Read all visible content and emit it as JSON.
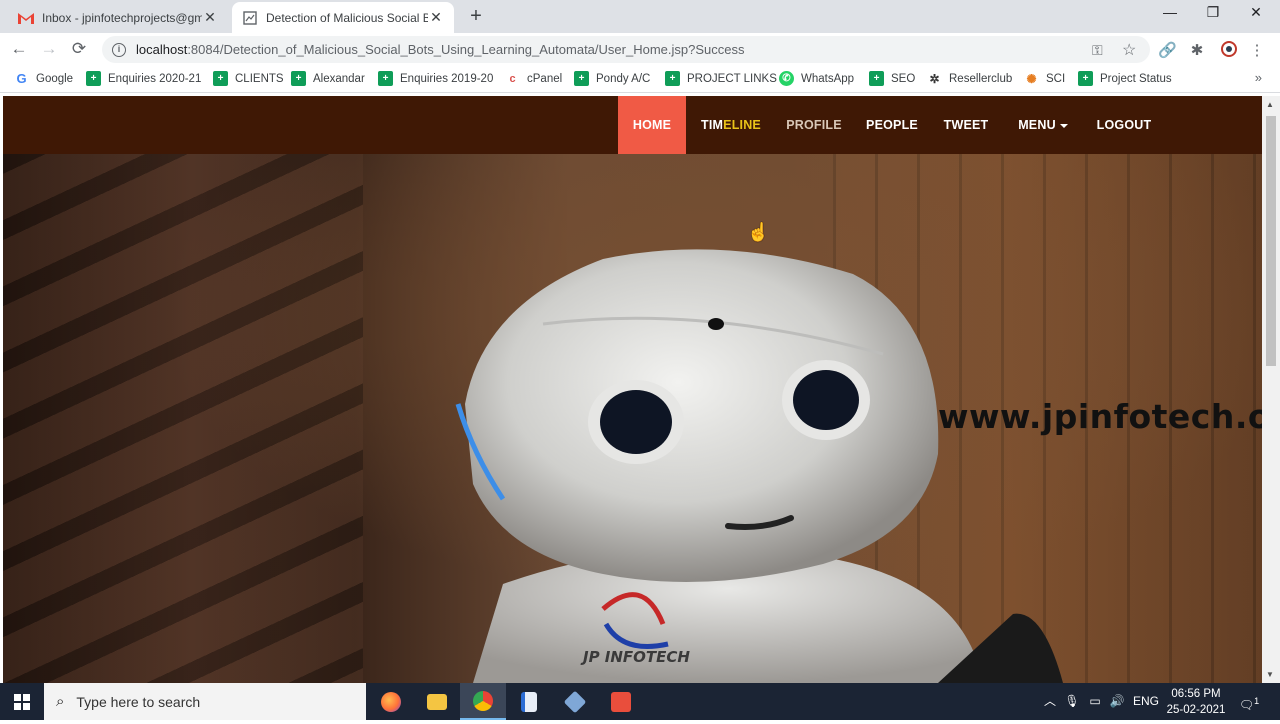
{
  "browser": {
    "tabs": [
      {
        "title": "Inbox - jpinfotechprojects@gmail.com",
        "favicon": "gmail-icon",
        "active": false
      },
      {
        "title": "Detection of Malicious Social Bots",
        "favicon": "page-icon",
        "active": true
      }
    ],
    "new_tab": "+",
    "window_controls": {
      "minimize": "—",
      "maximize": "❐",
      "close": "✕"
    },
    "url": {
      "host": "localhost",
      "path": ":8084/Detection_of_Malicious_Social_Bots_Using_Learning_Automata/User_Home.jsp?Success"
    },
    "bookmarks": [
      {
        "label": "Google",
        "icon": "google-icon"
      },
      {
        "label": "Enquiries 2020-21",
        "icon": "sheets-icon"
      },
      {
        "label": "CLIENTS",
        "icon": "sheets-icon"
      },
      {
        "label": "Alexandar",
        "icon": "sheets-icon"
      },
      {
        "label": "Enquiries 2019-20",
        "icon": "sheets-icon"
      },
      {
        "label": "cPanel",
        "icon": "cpanel-icon"
      },
      {
        "label": "Pondy A/C",
        "icon": "sheets-icon"
      },
      {
        "label": "PROJECT LINKS",
        "icon": "sheets-icon"
      },
      {
        "label": "WhatsApp",
        "icon": "whatsapp-icon"
      },
      {
        "label": "SEO",
        "icon": "sheets-icon"
      },
      {
        "label": "Resellerclub",
        "icon": "resellerclub-icon"
      },
      {
        "label": "SCI",
        "icon": "sci-icon"
      },
      {
        "label": "Project Status",
        "icon": "sheets-icon"
      }
    ],
    "bookmarks_more": "»"
  },
  "site": {
    "nav": {
      "home": "HOME",
      "timeline_a": "TIM",
      "timeline_b": "ELINE",
      "profile": "PROFILE",
      "people": "PEOPLE",
      "tweet": "TWEET",
      "menu": "MENU",
      "logout": "LOGOUT"
    },
    "watermark": "www.jpinfotech.org"
  },
  "taskbar": {
    "search_placeholder": "Type here to search",
    "apps": [
      "firefox-icon",
      "file-explorer-icon",
      "chrome-icon",
      "notepad-icon",
      "virtualbox-icon",
      "app-icon"
    ],
    "language": "ENG",
    "time": "06:56 PM",
    "date": "25-02-2021",
    "notification_count": "1"
  },
  "colors": {
    "site_header": "#3f1805",
    "nav_active": "#f05a45",
    "nav_hover": "#e9c319",
    "taskbar": "#1b2434"
  }
}
